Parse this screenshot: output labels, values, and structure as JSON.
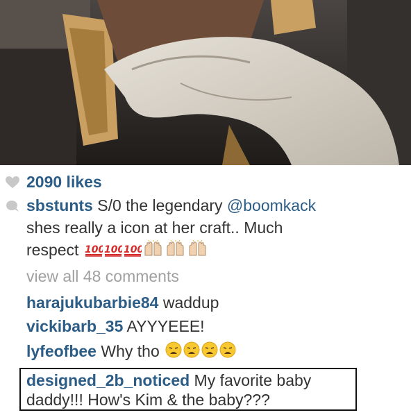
{
  "post": {
    "likes_label": "2090 likes",
    "caption": {
      "username": "sbstunts",
      "text_before_mention": " S/0 the legendary ",
      "mention": "@boomkack",
      "line2": "shes really a icon at her craft.. Much",
      "line3": "respect"
    },
    "view_comments_label": "view all 48 comments",
    "comments": [
      {
        "username": "harajukubarbie84",
        "text": " waddup"
      },
      {
        "username": "vickibarb_35",
        "text": " AYYYEEE!"
      },
      {
        "username": "lyfeofbee",
        "text": " Why tho"
      }
    ],
    "highlighted_comment": {
      "username": "designed_2b_noticed",
      "text_line1": " My favorite baby",
      "text_line2": "daddy!!! How's Kim & the baby???"
    }
  },
  "icons": {
    "likes": "heart-icon",
    "caption": "comment-bubble-icon",
    "emoji_100": "hundred-points-emoji",
    "emoji_hands": "raised-hands-emoji",
    "emoji_weary": "weary-face-emoji"
  },
  "colors": {
    "username": "#2c5d86",
    "muted": "#a0a0a0",
    "text": "#333333"
  }
}
